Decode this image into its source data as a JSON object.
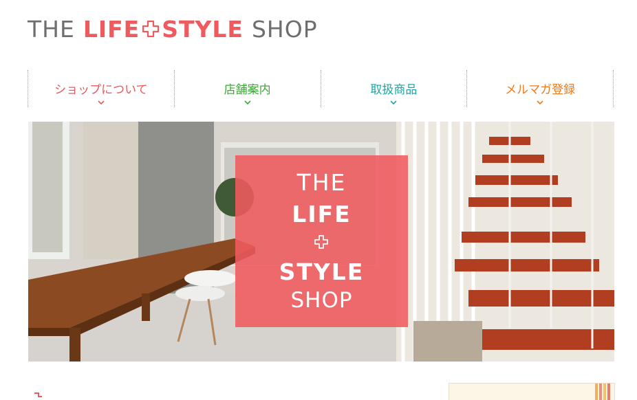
{
  "logo": {
    "the": "THE",
    "life": "LIFE",
    "style": "STYLE",
    "shop": "SHOP"
  },
  "nav": [
    {
      "label": "ショップについて",
      "color": "#e8585c"
    },
    {
      "label": "店舗案内",
      "color": "#3aa835"
    },
    {
      "label": "取扱商品",
      "color": "#1aa7a7"
    },
    {
      "label": "メルマガ登録",
      "color": "#f07a1a"
    }
  ],
  "hero": {
    "badge_line1": "THE",
    "badge_line2": "LIFE",
    "badge_line3": "STYLE",
    "badge_line4": "SHOP"
  },
  "colors": {
    "brand_red": "#ee5a5e",
    "logo_gray": "#6e6e6e"
  },
  "icons": [
    "plus-logo-icon",
    "chevron-down-icon"
  ]
}
